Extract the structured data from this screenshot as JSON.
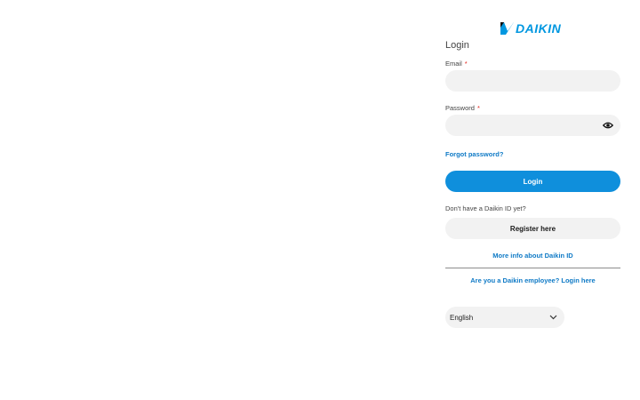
{
  "brand": {
    "name": "DAIKIN",
    "color": "#0097e0"
  },
  "login": {
    "heading": "Login",
    "email_label": "Email",
    "password_label": "Password",
    "required_marker": "*",
    "email_value": "",
    "password_value": "",
    "show_password_icon": "eye-icon",
    "forgot_password": "Forgot password?",
    "login_button": "Login"
  },
  "register": {
    "prompt": "Don't have a Daikin ID yet?",
    "button": "Register here",
    "more_info": "More info about Daikin ID"
  },
  "employee_login": "Are you a Daikin employee? Login here",
  "language": {
    "selected": "English",
    "icon": "chevron-down-icon"
  },
  "colors": {
    "primary": "#0f8fdc",
    "link": "#0f7ac6",
    "required": "#e2231a",
    "input_bg": "#f2f2f2"
  }
}
